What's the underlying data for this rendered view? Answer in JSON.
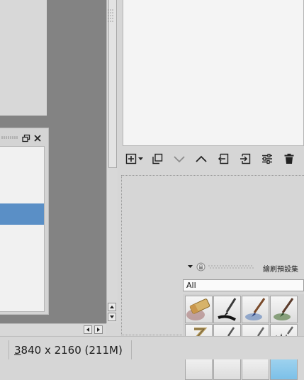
{
  "status_bar": {
    "image_size": "3840 x 2160 (211M)",
    "image_size_mnemonic": "3",
    "image_size_rest": "840 x 2160 (211M)"
  },
  "brush_presets": {
    "title": "繪刷預設集",
    "filter_value": "All"
  },
  "icons": {
    "float_restore": "restore-window-icon",
    "float_close": "close-icon",
    "layer_toolbar": [
      "add-layer-icon",
      "dropdown-arrow-icon",
      "duplicate-layer-icon",
      "move-layer-down-icon",
      "move-layer-up-icon",
      "move-out-of-group-icon",
      "move-into-group-icon",
      "layer-properties-icon",
      "delete-layer-icon"
    ],
    "presets": [
      "eraser-brush-icon",
      "ink-brush-icon",
      "blue-pen-brush-icon",
      "green-pen-brush-icon",
      "zigzag-brush-icon",
      "squiggle-brush-icon",
      "wavy-brush-icon",
      "scribble-brush-icon"
    ]
  },
  "colors": {
    "canvas_background": "#838383",
    "selection": "#5a8fc6",
    "panel": "#d6d6d6"
  }
}
